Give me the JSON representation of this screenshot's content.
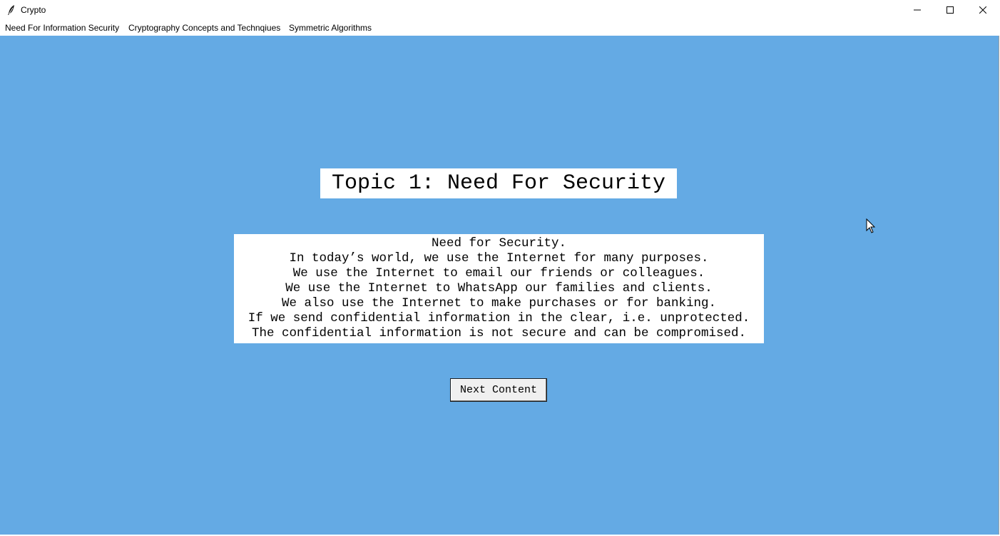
{
  "window": {
    "title": "Crypto",
    "minimize_icon": "minimize-icon",
    "maximize_icon": "maximize-icon",
    "close_icon": "close-icon",
    "app_icon": "feather-icon"
  },
  "menubar": {
    "items": [
      {
        "label": "Need For Information Security"
      },
      {
        "label": "Cryptography Concepts and Technqiues"
      },
      {
        "label": "Symmetric Algorithms"
      }
    ]
  },
  "main": {
    "title": "Topic 1: Need For Security",
    "body_lines": [
      "Need for Security.",
      "In today’s world, we use the Internet for many purposes.",
      "We use the Internet to email our friends or colleagues.",
      "We use the Internet to WhatsApp our families and clients.",
      "We also use the Internet to make purchases or for banking.",
      "If we send confidential information in the clear, i.e. unprotected.",
      "The confidential information is not secure and can be compromised."
    ],
    "next_button_label": "Next Content"
  },
  "colors": {
    "background": "#64aae4",
    "panel": "#ffffff"
  }
}
